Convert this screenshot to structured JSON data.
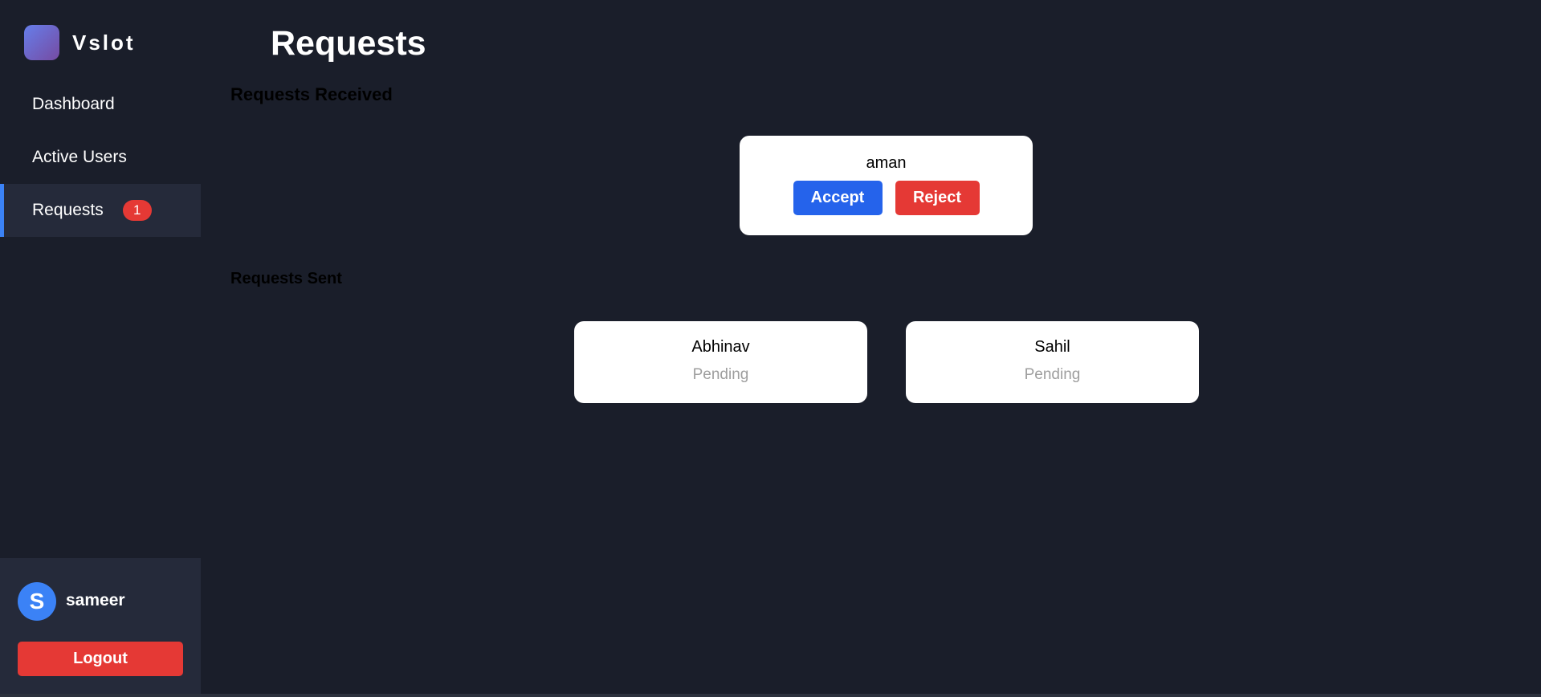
{
  "app": {
    "brand_name": "Vslot"
  },
  "sidebar": {
    "items": [
      {
        "label": "Dashboard"
      },
      {
        "label": "Active Users"
      },
      {
        "label": "Requests",
        "badge": "1"
      }
    ],
    "active_item": "Requests"
  },
  "user": {
    "avatar_initial": "S",
    "name": "sameer",
    "logout_label": "Logout"
  },
  "main": {
    "title": "Requests",
    "received": {
      "heading": "Requests Received",
      "items": [
        {
          "name": "aman",
          "accept_label": "Accept",
          "reject_label": "Reject"
        }
      ]
    },
    "sent": {
      "heading": "Requests Sent",
      "items": [
        {
          "name": "Abhinav",
          "status": "Pending"
        },
        {
          "name": "Sahil",
          "status": "Pending"
        }
      ]
    }
  },
  "colors": {
    "background": "#1a1e2a",
    "sidebar_active": "#252a3a",
    "accent_blue": "#2563eb",
    "danger_red": "#e53935",
    "card": "#ffffff",
    "status_gray": "#9e9e9e"
  },
  "icons": {
    "brand_logo": "gradient-square-logo"
  }
}
